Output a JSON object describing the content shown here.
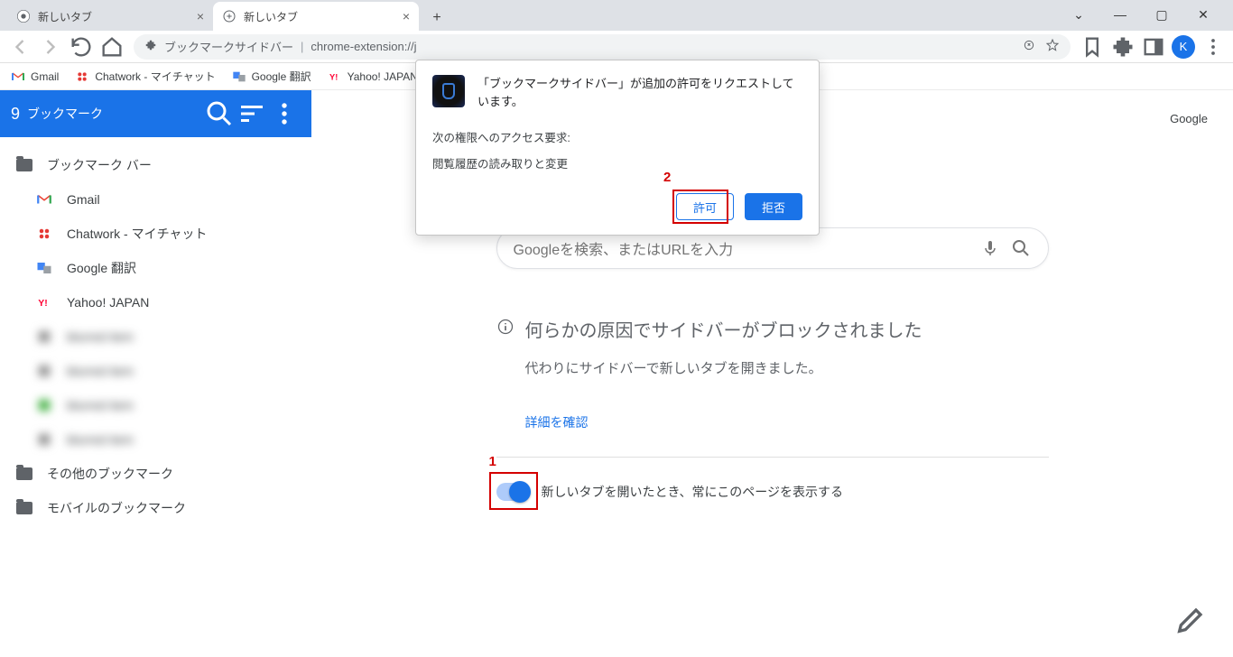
{
  "window": {
    "avatar_letter": "K"
  },
  "tabs": [
    {
      "title": "新しいタブ",
      "active": false
    },
    {
      "title": "新しいタブ",
      "active": true
    }
  ],
  "omnibox": {
    "extension_name": "ブックマークサイドバー",
    "separator": " | ",
    "url": "chrome-extension://j"
  },
  "bookmarks_bar": [
    {
      "label": "Gmail",
      "icon": "gmail"
    },
    {
      "label": "Chatwork - マイチャット",
      "icon": "chatwork"
    },
    {
      "label": "Google 翻訳",
      "icon": "translate"
    },
    {
      "label": "Yahoo! JAPAN",
      "icon": "yahoo"
    }
  ],
  "sidebar": {
    "count": "9",
    "title": "ブックマーク",
    "folders": [
      {
        "label": "ブックマーク バー",
        "type": "folder"
      },
      {
        "label": "Gmail",
        "type": "link",
        "icon": "gmail"
      },
      {
        "label": "Chatwork - マイチャット",
        "type": "link",
        "icon": "chatwork"
      },
      {
        "label": "Google 翻訳",
        "type": "link",
        "icon": "translate"
      },
      {
        "label": "Yahoo! JAPAN",
        "type": "link",
        "icon": "yahoo"
      },
      {
        "label": "blurred item",
        "type": "link",
        "blurred": true
      },
      {
        "label": "blurred item",
        "type": "link",
        "blurred": true
      },
      {
        "label": "blurred item",
        "type": "link",
        "blurred": true
      },
      {
        "label": "blurred item",
        "type": "link",
        "blurred": true
      },
      {
        "label": "その他のブックマーク",
        "type": "folder"
      },
      {
        "label": "モバイルのブックマーク",
        "type": "folder"
      }
    ]
  },
  "main": {
    "top_link": "Google",
    "search_placeholder": "Googleを検索、またはURLを入力",
    "blocked_title": "何らかの原因でサイドバーがブロックされました",
    "blocked_sub": "代わりにサイドバーで新しいタブを開きました。",
    "details_link": "詳細を確認",
    "toggle_label": "新しいタブを開いたとき、常にこのページを表示する"
  },
  "dialog": {
    "title": "「ブックマークサイドバー」が追加の許可をリクエストしています。",
    "body_label": "次の権限へのアクセス要求:",
    "body_item": "閲覧履歴の読み取りと変更",
    "allow": "許可",
    "deny": "拒否"
  },
  "annotations": {
    "one": "1",
    "two": "2"
  },
  "icons": {
    "gmail_colors": {
      "r": "#ea4335",
      "y": "#fbbc04",
      "g": "#34a853",
      "b": "#4285f4"
    }
  }
}
